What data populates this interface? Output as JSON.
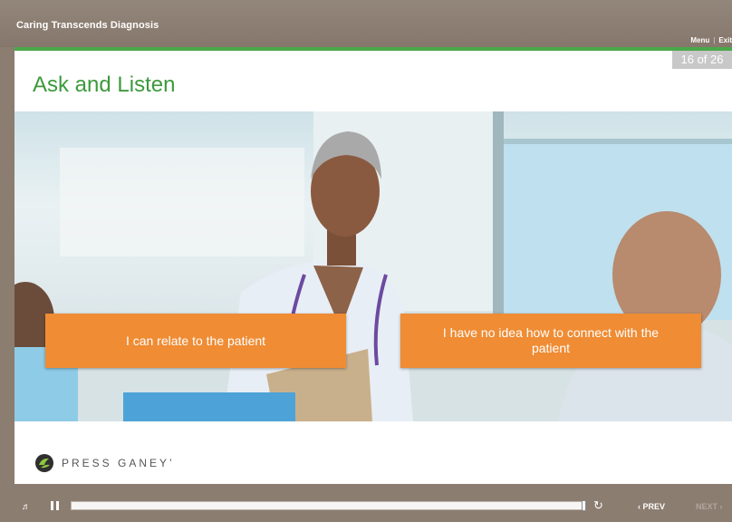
{
  "header": {
    "course_title": "Caring Transcends Diagnosis",
    "menu_label": "Menu",
    "separator": "|",
    "exit_label": "Exit"
  },
  "slide": {
    "page_counter": "16 of 26",
    "title": "Ask and Listen",
    "choices": [
      {
        "label": "I can relate to the patient"
      },
      {
        "label": "I have no idea how to connect with the patient"
      }
    ],
    "logo_text": "PRESS GANEY’"
  },
  "controls": {
    "volume_icon": "speaker-icon",
    "pause_icon": "pause-icon",
    "replay_icon": "replay-icon",
    "prev_label": "‹ PREV",
    "next_label": "NEXT ›",
    "progress": 1.0
  },
  "colors": {
    "frame": "#8b7d70",
    "accent_green": "#4aa84a",
    "title_green": "#3c9a3c",
    "choice_orange": "#ef8c34"
  }
}
